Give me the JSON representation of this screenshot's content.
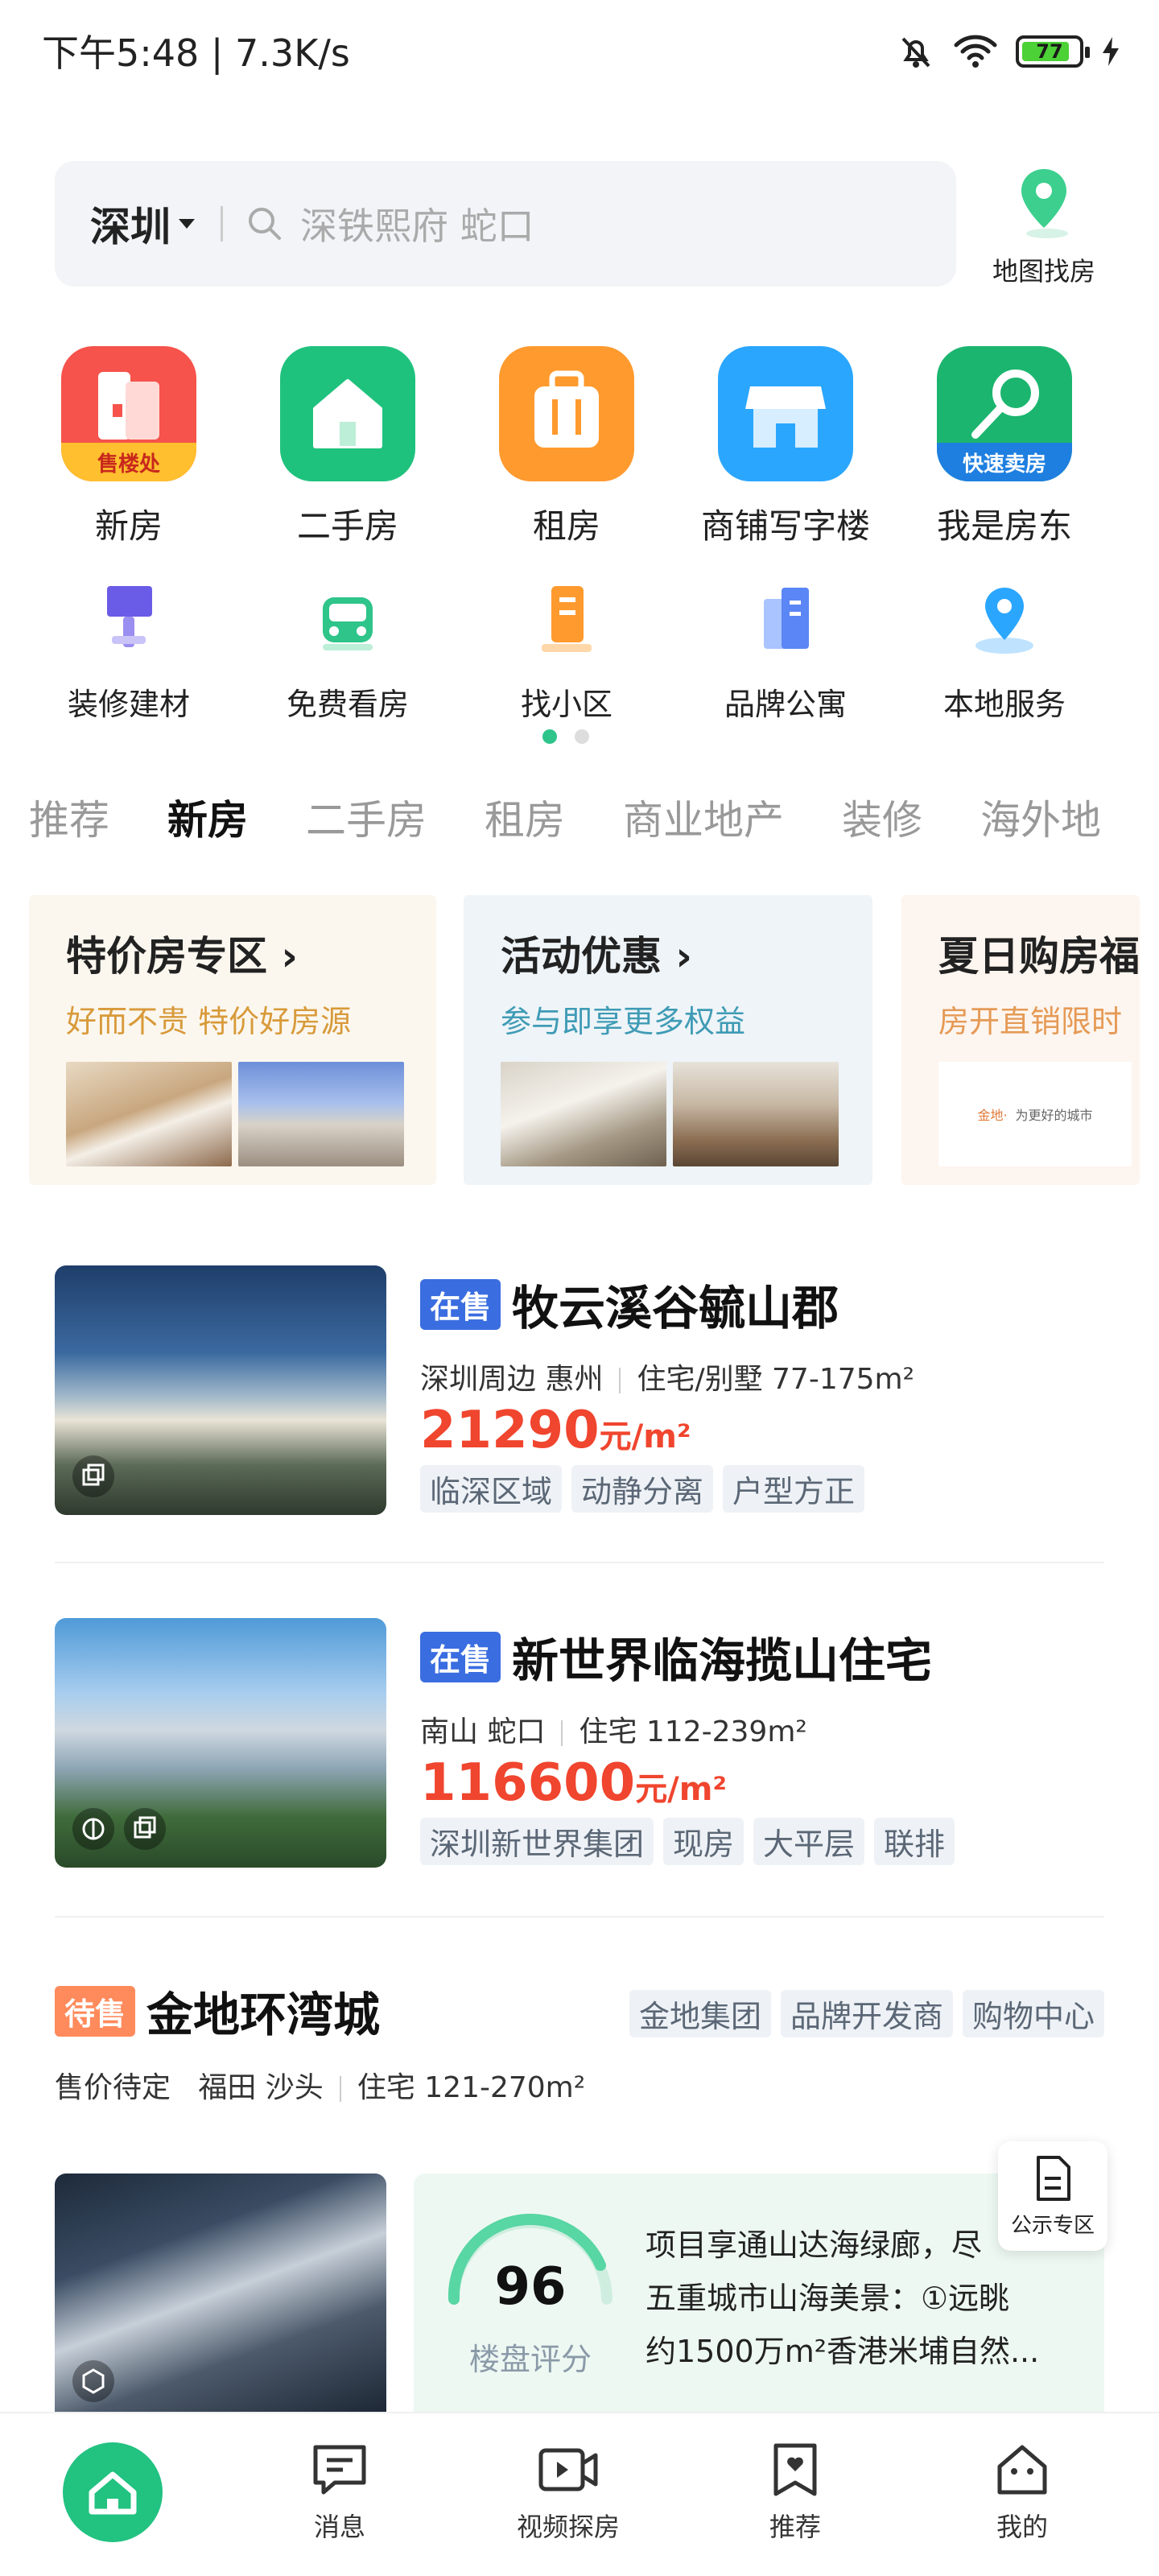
{
  "status_bar": {
    "time": "下午5:48 | 7.3K/s",
    "battery": "77"
  },
  "search": {
    "city": "深圳",
    "placeholder": "深铁熙府 蛇口",
    "map_button": "地图找房"
  },
  "main_categories": [
    {
      "label": "新房",
      "badge": "售楼处",
      "color": "#f5534b"
    },
    {
      "label": "二手房",
      "badge": "",
      "color": "#1fc27d"
    },
    {
      "label": "租房",
      "badge": "",
      "color": "#ff9a2e"
    },
    {
      "label": "商铺写字楼",
      "badge": "",
      "color": "#2aa6ff"
    },
    {
      "label": "我是房东",
      "badge": "快速卖房",
      "color": "#1bb56f"
    }
  ],
  "sub_categories": [
    {
      "label": "装修建材"
    },
    {
      "label": "免费看房"
    },
    {
      "label": "找小区"
    },
    {
      "label": "品牌公寓"
    },
    {
      "label": "本地服务"
    }
  ],
  "tabs": [
    "推荐",
    "新房",
    "二手房",
    "租房",
    "商业地产",
    "装修",
    "海外地"
  ],
  "active_tab": "新房",
  "promos": [
    {
      "title": "特价房专区",
      "subtitle": "好而不贵 特价好房源",
      "subtitle_color": "#d89a3a",
      "bg": "#fbf7ef"
    },
    {
      "title": "活动优惠",
      "subtitle": "参与即享更多权益",
      "subtitle_color": "#3f9bb5",
      "bg": "#eef4f8"
    },
    {
      "title": "夏日购房福",
      "subtitle": "房开直销限时",
      "subtitle_color": "#e59a56",
      "bg": "#fdf5ef"
    }
  ],
  "promo_extra_text": {
    "brand1": "金地·",
    "brand2": "为更好的城市"
  },
  "listings": [
    {
      "status": "在售",
      "name": "牧云溪谷毓山郡",
      "meta_area": "深圳周边  惠州",
      "meta_type": "住宅/别墅  77-175m²",
      "price": "21290",
      "unit": "元/m²",
      "tags": [
        "临深区域",
        "动静分离",
        "户型方正"
      ]
    },
    {
      "status": "在售",
      "name": "新世界临海揽山住宅",
      "meta_area": "南山  蛇口",
      "meta_type": "住宅  112-239m²",
      "price": "116600",
      "unit": "元/m²",
      "tags": [
        "深圳新世界集团",
        "现房",
        "大平层",
        "联排"
      ]
    },
    {
      "status": "待售",
      "name": "金地环湾城",
      "brand_tags": [
        "金地集团",
        "品牌开发商",
        "购物中心"
      ],
      "meta_price": "售价待定",
      "meta_area": "福田  沙头",
      "meta_type": "住宅  121-270m²",
      "score": "96",
      "score_label": "楼盘评分",
      "desc_lines": [
        "项目享通山达海绿廊，尽",
        "五重城市山海美景：①远眺",
        "约1500万m²香港米埔自然..."
      ]
    }
  ],
  "float_button": "公示专区",
  "bottom_nav": [
    {
      "label": ""
    },
    {
      "label": "消息"
    },
    {
      "label": "视频探房"
    },
    {
      "label": "推荐"
    },
    {
      "label": "我的"
    }
  ]
}
